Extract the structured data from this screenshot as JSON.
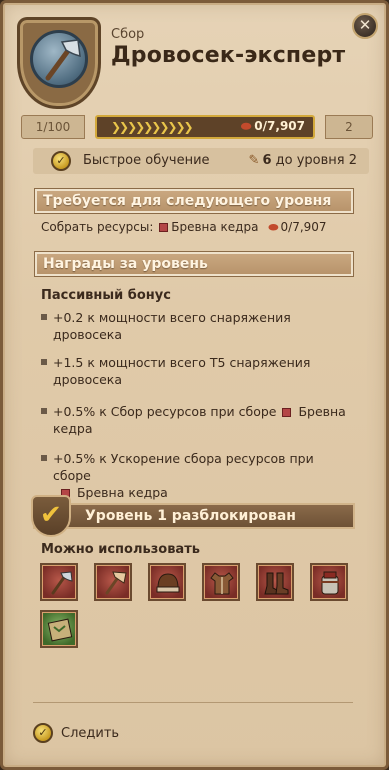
{
  "header": {
    "category": "Сбор",
    "title": "Дровосек-эксперт",
    "close_label": "✕",
    "emblem_icon": "axe-icon"
  },
  "progress": {
    "current_level": "1/100",
    "next_level": "2",
    "value_text": "0/7,907",
    "fill_fraction": 0.0,
    "accent": "#d3a93b"
  },
  "quick_learn": {
    "label": "Быстрое обучение",
    "count": "6",
    "suffix": "до уровня 2",
    "coin_icon": "check-coin-icon",
    "book_icon": "book-icon"
  },
  "requirements": {
    "header": "Требуется для следующего уровня",
    "prefix": "Собрать ресурсы:",
    "resource": "Бревна кедра",
    "amount": "0/7,907"
  },
  "rewards": {
    "header": "Награды за уровень",
    "passive_title": "Пассивный бонус",
    "bonuses": [
      {
        "line1": "+0.2 к мощности всего снаряжения",
        "line2": "дровосека"
      },
      {
        "line1": "+1.5 к мощности всего T5 снаряжения",
        "line2": "дровосека"
      },
      {
        "line1": "+0.5% к Сбор ресурсов при сборе",
        "resource": "Бревна",
        "line2": "кедра"
      },
      {
        "line1": "+0.5% к Ускорение сбора ресурсов при сборе",
        "resource": "Бревна кедра"
      }
    ]
  },
  "unlock": {
    "banner": "Уровень 1 разблокирован",
    "usable_label": "Можно использовать",
    "items": [
      {
        "icon": "axe-icon"
      },
      {
        "icon": "axe-icon"
      },
      {
        "icon": "cap-icon"
      },
      {
        "icon": "armor-icon"
      },
      {
        "icon": "boots-icon"
      },
      {
        "icon": "backpack-icon"
      },
      {
        "icon": "map-icon"
      }
    ]
  },
  "footer": {
    "follow_label": "Следить"
  }
}
